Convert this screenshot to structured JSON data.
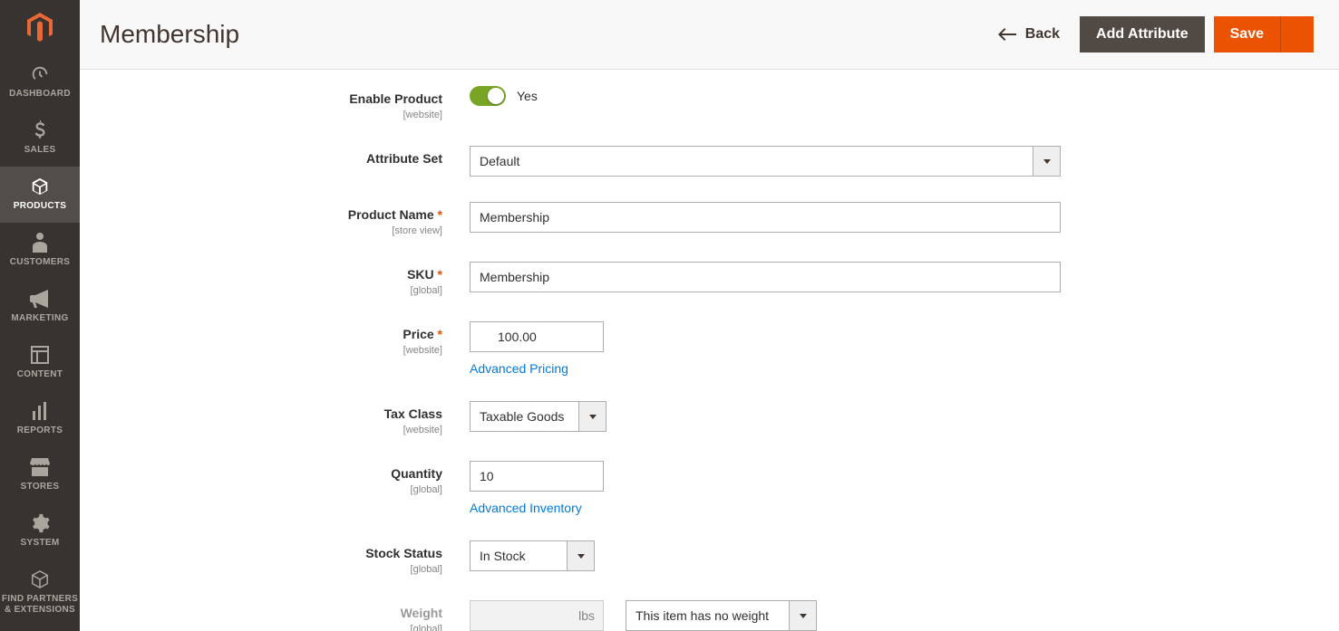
{
  "sidebar": {
    "items": [
      {
        "label": "DASHBOARD",
        "icon": "dashboard"
      },
      {
        "label": "SALES",
        "icon": "sales"
      },
      {
        "label": "PRODUCTS",
        "icon": "products",
        "active": true
      },
      {
        "label": "CUSTOMERS",
        "icon": "customers"
      },
      {
        "label": "MARKETING",
        "icon": "marketing"
      },
      {
        "label": "CONTENT",
        "icon": "content"
      },
      {
        "label": "REPORTS",
        "icon": "reports"
      },
      {
        "label": "STORES",
        "icon": "stores"
      },
      {
        "label": "SYSTEM",
        "icon": "system"
      },
      {
        "label": "FIND PARTNERS\n& EXTENSIONS",
        "icon": "partners"
      }
    ]
  },
  "header": {
    "title": "Membership",
    "back_label": "Back",
    "add_attribute_label": "Add Attribute",
    "save_label": "Save"
  },
  "form": {
    "enable_product": {
      "label": "Enable Product",
      "scope": "[website]",
      "value_text": "Yes",
      "value": true
    },
    "attribute_set": {
      "label": "Attribute Set",
      "value": "Default"
    },
    "product_name": {
      "label": "Product Name",
      "scope": "[store view]",
      "value": "Membership",
      "required": true
    },
    "sku": {
      "label": "SKU",
      "scope": "[global]",
      "value": "Membership",
      "required": true
    },
    "price": {
      "label": "Price",
      "scope": "[website]",
      "currency": "$",
      "value": "100.00",
      "required": true,
      "advanced_link": "Advanced Pricing"
    },
    "tax_class": {
      "label": "Tax Class",
      "scope": "[website]",
      "value": "Taxable Goods"
    },
    "quantity": {
      "label": "Quantity",
      "scope": "[global]",
      "value": "10",
      "advanced_link": "Advanced Inventory"
    },
    "stock_status": {
      "label": "Stock Status",
      "scope": "[global]",
      "value": "In Stock"
    },
    "weight": {
      "label": "Weight",
      "scope": "[global]",
      "unit": "lbs",
      "value": "",
      "type_value": "This item has no weight"
    }
  }
}
